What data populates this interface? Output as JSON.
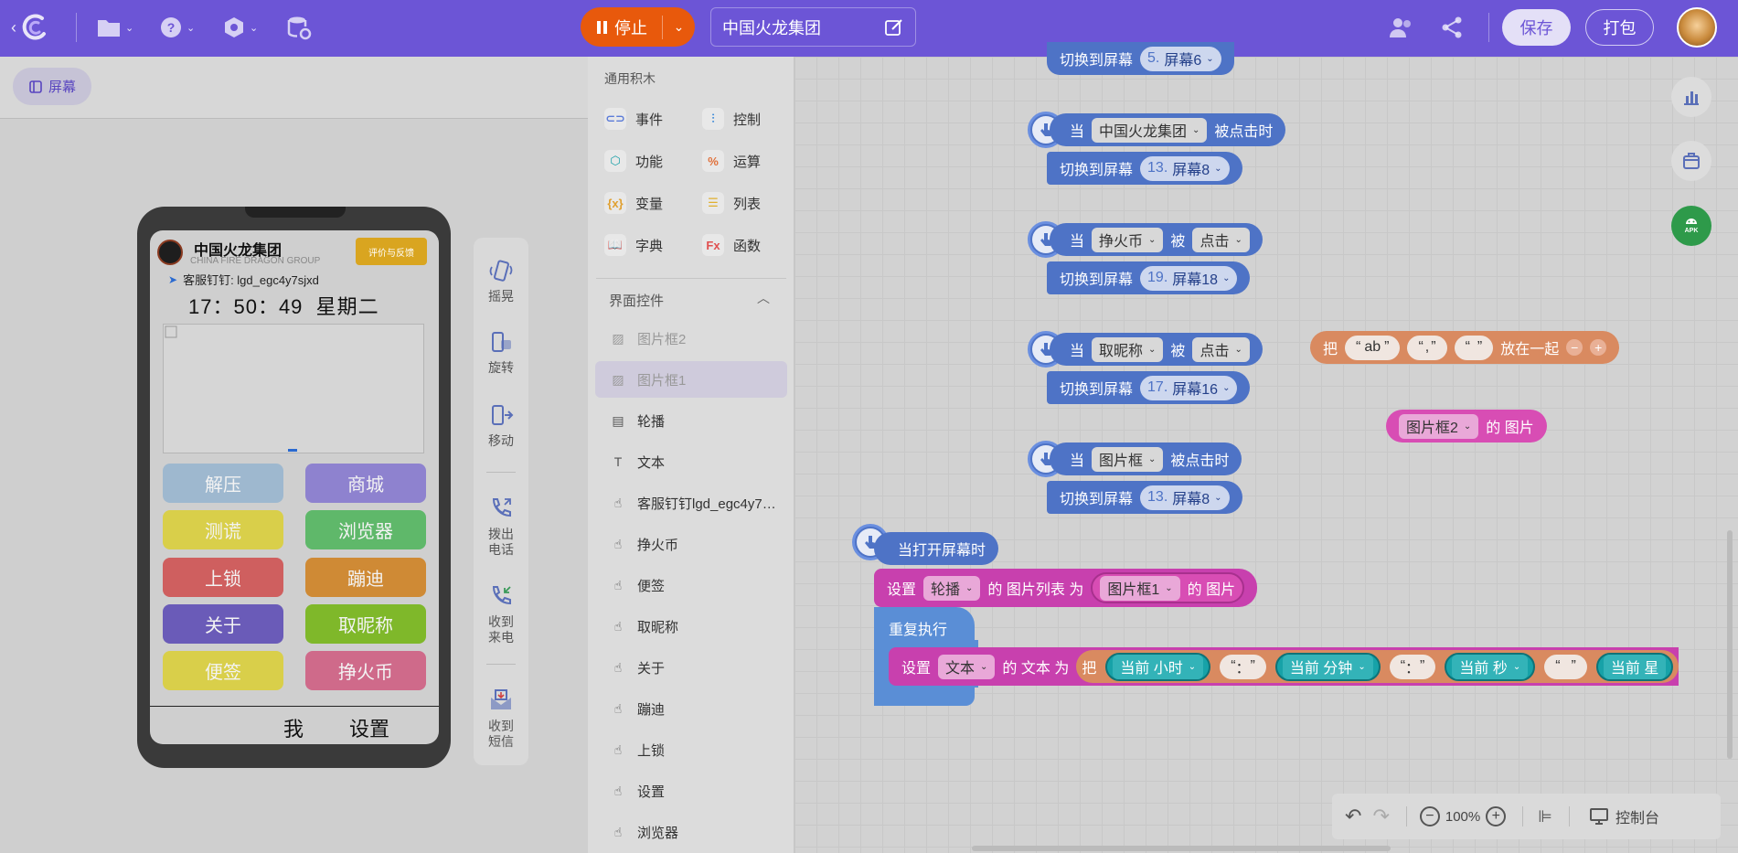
{
  "topbar": {
    "stop_label": "停止",
    "project_name": "中国火龙集团",
    "save_label": "保存",
    "pack_label": "打包"
  },
  "left": {
    "screen_button": "屏幕",
    "phone": {
      "brand_title": "中国火龙集团",
      "brand_subtitle": "CHINA FIRE DRAGON GROUP",
      "rate_button": "评价与反馈",
      "service_text": "客服钉钉: lgd_egc4y7sjxd",
      "clock_text": "17：50：49  星期二",
      "buttons": [
        {
          "label": "解压",
          "color": "#9eb8cf"
        },
        {
          "label": "商城",
          "color": "#8e82cf"
        },
        {
          "label": "测谎",
          "color": "#d9cf4a"
        },
        {
          "label": "浏览器",
          "color": "#5fb86a"
        },
        {
          "label": "上锁",
          "color": "#cf5f5f"
        },
        {
          "label": "蹦迪",
          "color": "#cf8a35"
        },
        {
          "label": "关于",
          "color": "#6a5bb8"
        },
        {
          "label": "取昵称",
          "color": "#7fb82a"
        },
        {
          "label": "便签",
          "color": "#d9cf4a"
        },
        {
          "label": "挣火币",
          "color": "#cf6a8a"
        }
      ],
      "bottom_nav": [
        "我",
        "设置"
      ]
    },
    "tools": [
      "摇晃",
      "旋转",
      "移动",
      "拨出\n电话",
      "收到\n来电",
      "收到\n短信"
    ]
  },
  "palette": {
    "section_common": "通用积木",
    "categories": [
      {
        "label": "事件",
        "icon": "toggle-icon",
        "color": "#5b7bd8"
      },
      {
        "label": "控制",
        "icon": "sliders-icon",
        "color": "#3c8ad8"
      },
      {
        "label": "功能",
        "icon": "cube-icon",
        "color": "#1aa0a8"
      },
      {
        "label": "运算",
        "icon": "percent-icon",
        "color": "#e0703a"
      },
      {
        "label": "变量",
        "icon": "braces-icon",
        "color": "#e0a030"
      },
      {
        "label": "列表",
        "icon": "list-icon",
        "color": "#e0b030"
      },
      {
        "label": "字典",
        "icon": "book-icon",
        "color": "#6a7bd8"
      },
      {
        "label": "函数",
        "icon": "fx-icon",
        "color": "#e05050"
      }
    ],
    "section_ui": "界面控件",
    "items": [
      {
        "label": "图片框2",
        "icon": "image-icon"
      },
      {
        "label": "图片框1",
        "icon": "image-icon"
      },
      {
        "label": "轮播",
        "icon": "carousel-icon"
      },
      {
        "label": "文本",
        "icon": "text-icon"
      },
      {
        "label": "客服钉钉lgd_egc4y7…",
        "icon": "button-icon"
      },
      {
        "label": "挣火币",
        "icon": "button-icon"
      },
      {
        "label": "便签",
        "icon": "button-icon"
      },
      {
        "label": "取昵称",
        "icon": "button-icon"
      },
      {
        "label": "关于",
        "icon": "button-icon"
      },
      {
        "label": "蹦迪",
        "icon": "button-icon"
      },
      {
        "label": "上锁",
        "icon": "button-icon"
      },
      {
        "label": "设置",
        "icon": "button-icon"
      },
      {
        "label": "浏览器",
        "icon": "button-icon"
      }
    ]
  },
  "blocks": {
    "when": "当",
    "clicked": "被点击时",
    "be": "被",
    "click": "点击",
    "switch_to": "切换到屏幕",
    "top_partial": {
      "num": "5.",
      "screen": "屏幕6"
    },
    "events": [
      {
        "target": "中国火龙集团",
        "style": "clicked",
        "num": "13.",
        "screen": "屏幕8"
      },
      {
        "target": "挣火币",
        "style": "be",
        "num": "19.",
        "screen": "屏幕18"
      },
      {
        "target": "取昵称",
        "style": "be",
        "num": "17.",
        "screen": "屏幕16"
      },
      {
        "target": "图片框",
        "style": "clicked",
        "num": "13.",
        "screen": "屏幕8"
      }
    ],
    "join": {
      "label": "把",
      "s1": "ab",
      "s2": ",",
      "s3": "",
      "tail": "放在一起"
    },
    "picture": {
      "target": "图片框2",
      "tail": "的 图片"
    },
    "on_open": "当打开屏幕时",
    "set": "设置",
    "set_carousel": {
      "target": "轮播",
      "prop": "的 图片列表 为",
      "value": "图片框1",
      "tail": "的 图片"
    },
    "repeat": "重复执行",
    "set_text": {
      "target": "文本",
      "prop": "的 文本 为",
      "join": "把",
      "hour": "当前 小时",
      "sep1": "：",
      "minute": "当前 分钟",
      "sep2": "：",
      "second": "当前 秒",
      "space": "",
      "cut": "当前 星"
    }
  },
  "bottom": {
    "zoom": "100%",
    "console": "控制台"
  }
}
